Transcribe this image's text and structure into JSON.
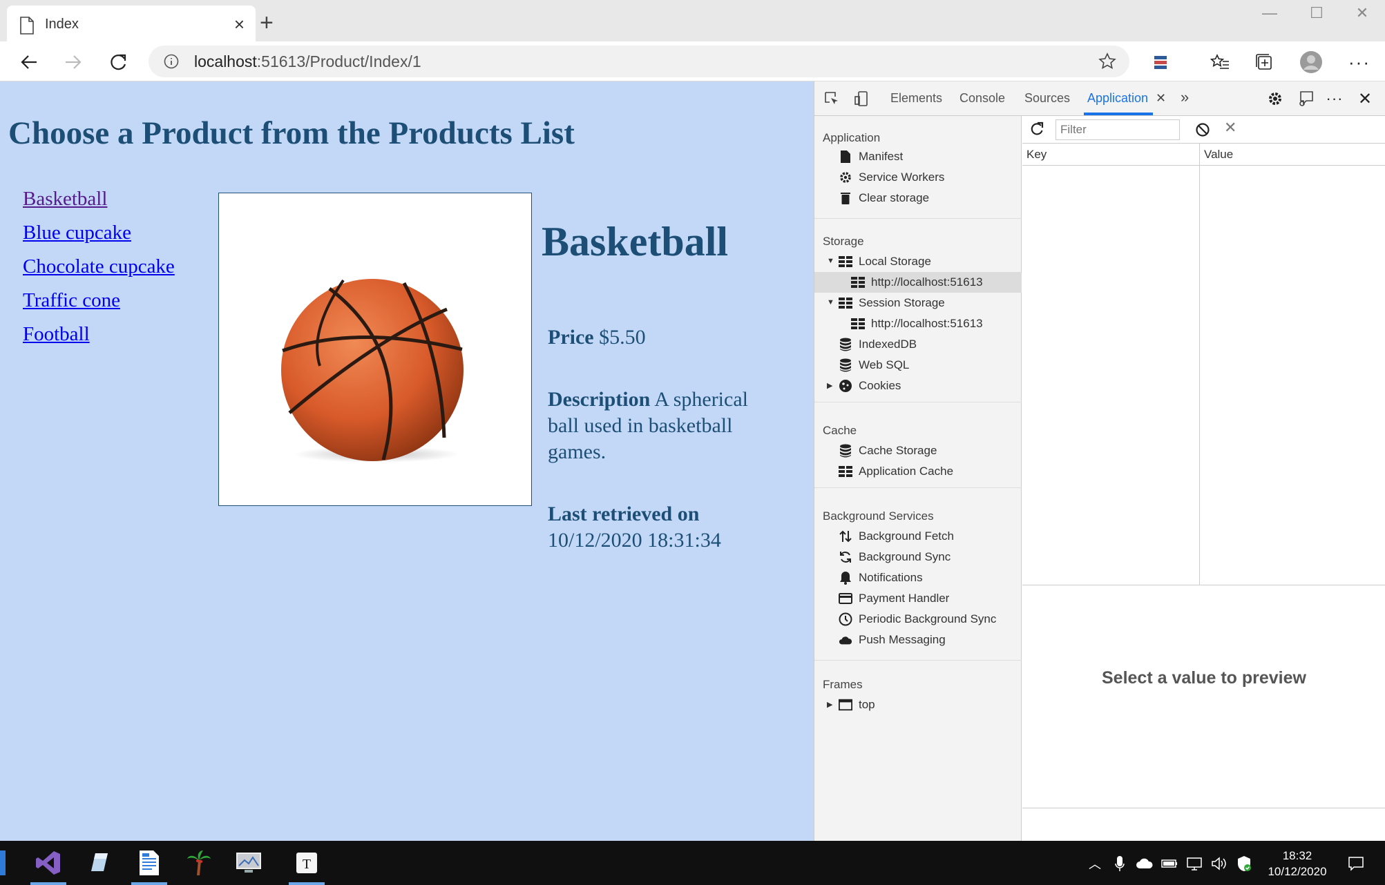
{
  "browser": {
    "tab_title": "Index",
    "url_host": "localhost",
    "url_path": ":51613/Product/Index/1"
  },
  "page": {
    "heading": "Choose a Product from the Products List",
    "products": [
      "Basketball",
      "Blue cupcake",
      "Chocolate cupcake",
      "Traffic cone",
      "Football"
    ],
    "selected_name": "Basketball",
    "price_label": "Price",
    "price_value": "$5.50",
    "description_label": "Description",
    "description_value": "A spherical ball used in basketball games.",
    "retrieved_label": "Last retrieved on",
    "retrieved_value": "10/12/2020 18:31:34",
    "colors": {
      "background": "#c3d8f6",
      "heading": "#1d4f76",
      "link": "#0000ee",
      "visited_link": "#551a8b"
    }
  },
  "devtools": {
    "tabs": [
      "Elements",
      "Console",
      "Sources",
      "Application"
    ],
    "active_tab": "Application",
    "sections": {
      "application": {
        "title": "Application",
        "items": [
          {
            "label": "Manifest",
            "icon": "document-icon"
          },
          {
            "label": "Service Workers",
            "icon": "gear-icon"
          },
          {
            "label": "Clear storage",
            "icon": "trash-icon"
          }
        ]
      },
      "storage": {
        "title": "Storage",
        "items": [
          {
            "label": "Local Storage",
            "icon": "grid-icon"
          },
          {
            "label": "http://localhost:51613",
            "icon": "grid-icon"
          },
          {
            "label": "Session Storage",
            "icon": "grid-icon"
          },
          {
            "label": "http://localhost:51613",
            "icon": "grid-icon"
          },
          {
            "label": "IndexedDB",
            "icon": "database-icon"
          },
          {
            "label": "Web SQL",
            "icon": "database-icon"
          },
          {
            "label": "Cookies",
            "icon": "cookie-icon"
          }
        ]
      },
      "cache": {
        "title": "Cache",
        "items": [
          {
            "label": "Cache Storage",
            "icon": "database-icon"
          },
          {
            "label": "Application Cache",
            "icon": "grid-icon"
          }
        ]
      },
      "background": {
        "title": "Background Services",
        "items": [
          {
            "label": "Background Fetch",
            "icon": "updown-arrows-icon"
          },
          {
            "label": "Background Sync",
            "icon": "sync-icon"
          },
          {
            "label": "Notifications",
            "icon": "bell-icon"
          },
          {
            "label": "Payment Handler",
            "icon": "card-icon"
          },
          {
            "label": "Periodic Background Sync",
            "icon": "clock-icon"
          },
          {
            "label": "Push Messaging",
            "icon": "cloud-icon"
          }
        ]
      },
      "frames": {
        "title": "Frames",
        "items": [
          {
            "label": "top",
            "icon": "frame-icon"
          }
        ]
      }
    },
    "filter_placeholder": "Filter",
    "columns": [
      "Key",
      "Value"
    ],
    "preview_text": "Select a value to preview"
  },
  "taskbar": {
    "time": "18:32",
    "date": "10/12/2020"
  }
}
